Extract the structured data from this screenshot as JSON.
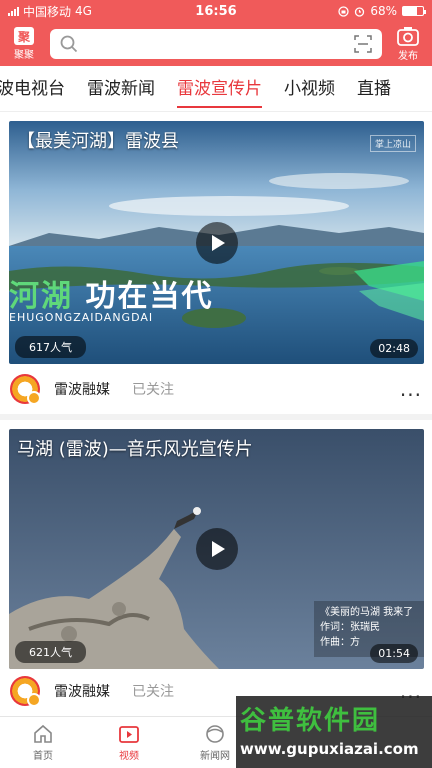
{
  "status_bar": {
    "carrier": "中国移动",
    "network": "4G",
    "time": "16:56",
    "battery": "68%",
    "battery_level": 0.68
  },
  "header": {
    "logo_glyph": "聚",
    "logo_label": "聚聚",
    "search_placeholder": "",
    "publish_label": "发布"
  },
  "tabs": [
    {
      "label": "波电视台"
    },
    {
      "label": "雷波新闻"
    },
    {
      "label": "雷波宣传片",
      "active": true
    },
    {
      "label": "小视频"
    },
    {
      "label": "直播"
    }
  ],
  "feed": [
    {
      "title": "【最美河湖】雷波县",
      "overlay_text_green": "河湖",
      "overlay_text_white": "功在当代",
      "overlay_sub": "EHUGONGZAIDANGDAI",
      "channel_tag": "掌上凉山",
      "views": "617人气",
      "duration": "02:48",
      "media_name": "雷波融媒",
      "follow_status": "已关注",
      "more": "..."
    },
    {
      "title": "马湖 (雷波)—音乐风光宣传片",
      "caption_line1": "《美丽的马湖 我来了",
      "caption_line2": "作词：张瑞民",
      "caption_line3": "作曲：方",
      "views": "621人气",
      "duration": "01:54",
      "media_name": "雷波融媒",
      "follow_status": "已关注",
      "more": "..."
    }
  ],
  "bottom_nav": [
    {
      "label": "首页"
    },
    {
      "label": "视频",
      "active": true
    },
    {
      "label": "新闻网"
    },
    {
      "label": ""
    },
    {
      "label": ""
    }
  ],
  "watermark": {
    "title": "谷普软件园",
    "url": "www.gupuxiazai.com"
  },
  "colors": {
    "brand": "#f05a5a",
    "active_tab": "#e8383d"
  }
}
